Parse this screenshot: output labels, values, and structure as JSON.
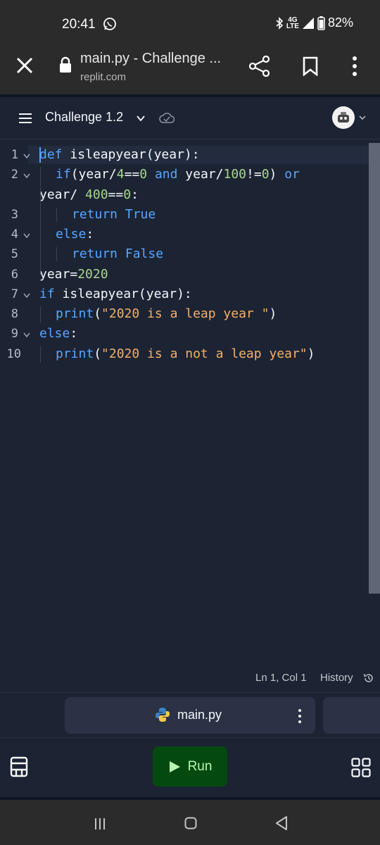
{
  "status_bar": {
    "time": "20:41",
    "network": "4G",
    "network_sub": "LTE",
    "battery": "82%"
  },
  "browser": {
    "title": "main.py - Challenge ...",
    "url": "replit.com"
  },
  "repl": {
    "name": "Challenge 1.2"
  },
  "editor": {
    "line_numbers": [
      "1",
      "2",
      "3",
      "4",
      "5",
      "6",
      "7",
      "8",
      "9",
      "10"
    ],
    "lines": [
      [
        {
          "t": "def",
          "c": "kw"
        },
        {
          "t": " isleapyear",
          "c": "fn"
        },
        {
          "t": "(year):",
          "c": ""
        }
      ],
      [
        {
          "t": "if",
          "c": "kw"
        },
        {
          "t": "(year/",
          "c": ""
        },
        {
          "t": "4",
          "c": "num"
        },
        {
          "t": "==",
          "c": ""
        },
        {
          "t": "0",
          "c": "num"
        },
        {
          "t": " ",
          "c": ""
        },
        {
          "t": "and",
          "c": "kw"
        },
        {
          "t": " year/",
          "c": ""
        },
        {
          "t": "100",
          "c": "num"
        },
        {
          "t": "!=",
          "c": ""
        },
        {
          "t": "0",
          "c": "num"
        },
        {
          "t": ") ",
          "c": ""
        },
        {
          "t": "or",
          "c": "kw"
        }
      ],
      [
        {
          "t": "year/ ",
          "c": ""
        },
        {
          "t": "400",
          "c": "num"
        },
        {
          "t": "==",
          "c": ""
        },
        {
          "t": "0",
          "c": "num"
        },
        {
          "t": ":",
          "c": ""
        }
      ],
      [
        {
          "t": "return",
          "c": "kw"
        },
        {
          "t": " True",
          "c": "kw"
        }
      ],
      [
        {
          "t": "else",
          "c": "kw"
        },
        {
          "t": ":",
          "c": ""
        }
      ],
      [
        {
          "t": "return",
          "c": "kw"
        },
        {
          "t": " False",
          "c": "kw"
        }
      ],
      [
        {
          "t": "year=",
          "c": ""
        },
        {
          "t": "2020",
          "c": "num"
        }
      ],
      [
        {
          "t": "if",
          "c": "kw"
        },
        {
          "t": " isleapyear(year):",
          "c": ""
        }
      ],
      [
        {
          "t": "print",
          "c": "kw"
        },
        {
          "t": "(",
          "c": ""
        },
        {
          "t": "\"2020 is a leap year \"",
          "c": "str"
        },
        {
          "t": ")",
          "c": ""
        }
      ],
      [
        {
          "t": "else",
          "c": "kw"
        },
        {
          "t": ":",
          "c": ""
        }
      ],
      [
        {
          "t": "print",
          "c": "kw"
        },
        {
          "t": "(",
          "c": ""
        },
        {
          "t": "\"2020 is a not a leap year\"",
          "c": "str"
        },
        {
          "t": ")",
          "c": ""
        }
      ]
    ]
  },
  "editor_status": {
    "cursor_position": "Ln 1, Col 1",
    "history_label": "History"
  },
  "file_tab": {
    "name": "main.py"
  },
  "run_button": {
    "label": "Run"
  },
  "colors": {
    "background": "#1c2333",
    "keyword": "#58a6ff",
    "number": "#a8d88a",
    "string": "#f4b06a",
    "run_button": "#044a10"
  }
}
